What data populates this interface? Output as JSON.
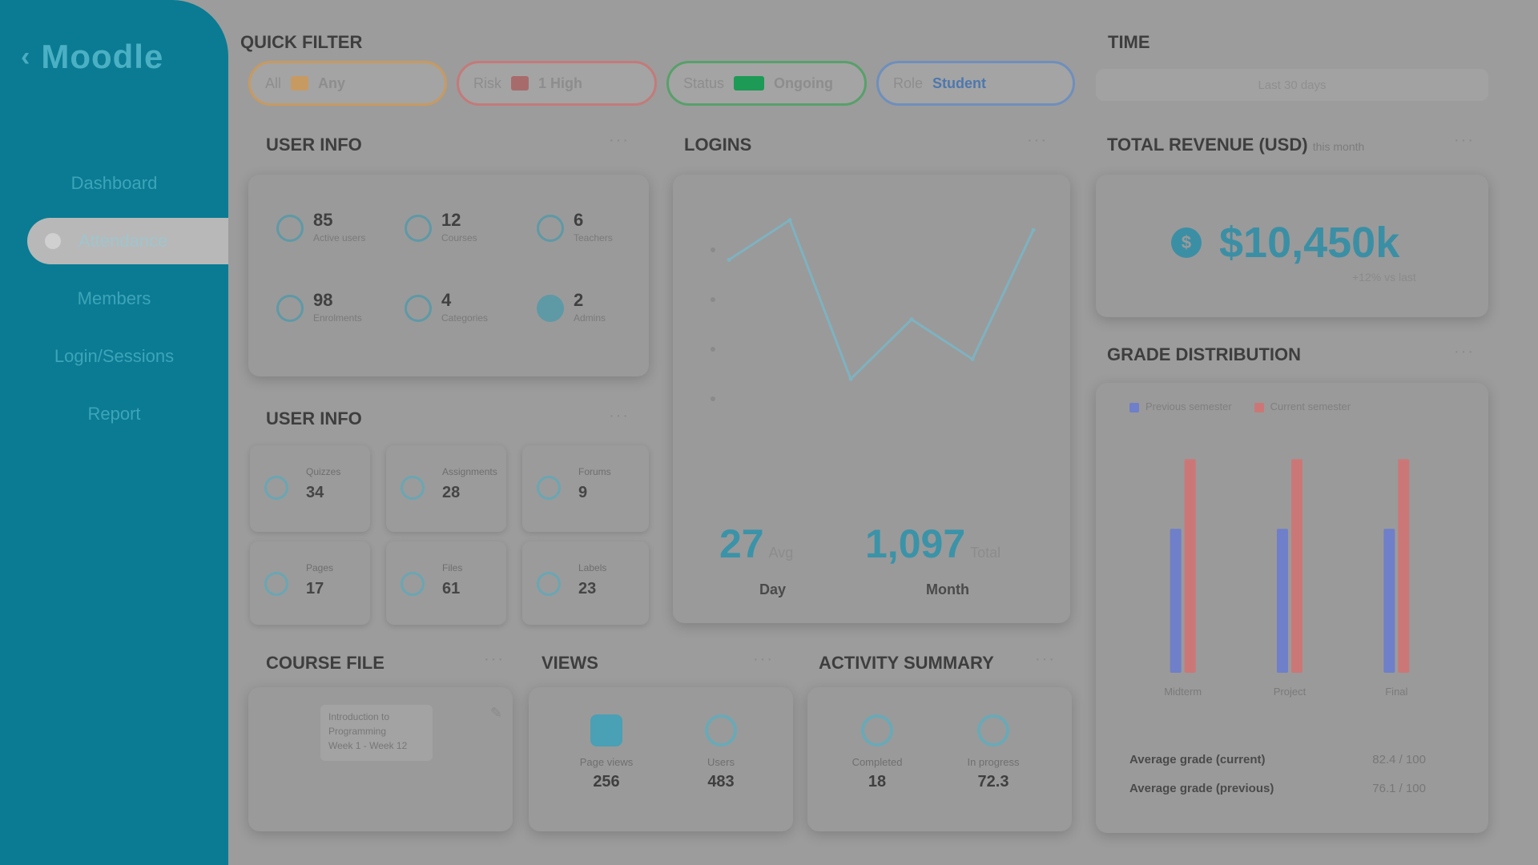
{
  "sidebar": {
    "brand": "Moodle",
    "items": [
      {
        "label": "Dashboard"
      },
      {
        "label": "Attendance"
      },
      {
        "label": "Members"
      },
      {
        "label": "Login/Sessions"
      },
      {
        "label": "Report"
      }
    ]
  },
  "filters": {
    "label": "QUICK FILTER",
    "chips": [
      {
        "text": "All",
        "value": "Any",
        "color": "#c79a62"
      },
      {
        "text": "Risk",
        "value": "1 High",
        "color": "#c47a7a"
      },
      {
        "text": "Status",
        "value": "Ongoing",
        "color": "#58a06a"
      },
      {
        "text": "Role",
        "value": "Student",
        "color": "#6e8fbd"
      }
    ]
  },
  "range": {
    "label": "TIME",
    "value": "Last 30 days"
  },
  "panels": {
    "info_a": {
      "title": "USER INFO"
    },
    "info_b": {
      "title": "USER INFO"
    },
    "chart": {
      "title": "LOGINS"
    },
    "total": {
      "title": "TOTAL REVENUE (USD)",
      "title_note": "this month",
      "value": "$10,450k",
      "sub": "+12% vs last"
    },
    "grouped": {
      "title": "GRADE DISTRIBUTION"
    },
    "course_file": {
      "title": "COURSE FILE"
    },
    "sessions": {
      "title": "VIEWS"
    },
    "activity": {
      "title": "ACTIVITY SUMMARY"
    }
  },
  "metrics_a": [
    {
      "num": "85",
      "sub": "Active users"
    },
    {
      "num": "12",
      "sub": "Courses"
    },
    {
      "num": "6",
      "sub": "Teachers"
    },
    {
      "num": "98",
      "sub": "Enrolments"
    },
    {
      "num": "4",
      "sub": "Categories"
    },
    {
      "num": "2",
      "sub": "Admins"
    }
  ],
  "tiles": [
    {
      "t1": "Quizzes",
      "t2": "34"
    },
    {
      "t1": "Assignments",
      "t2": "28"
    },
    {
      "t1": "Forums",
      "t2": "9"
    },
    {
      "t1": "Pages",
      "t2": "17"
    },
    {
      "t1": "Files",
      "t2": "61"
    },
    {
      "t1": "Labels",
      "t2": "23"
    }
  ],
  "chart_stats": [
    {
      "value": "27",
      "unit": "Avg",
      "label": "Day"
    },
    {
      "value": "1,097",
      "unit": "Total",
      "label": "Month"
    }
  ],
  "legend": [
    "Previous semester",
    "Current semester"
  ],
  "grade_categories": [
    "Midterm",
    "Project",
    "Final"
  ],
  "summary_rows": [
    {
      "k": "Average grade (current)",
      "v": "82.4 / 100"
    },
    {
      "k": "Average grade (previous)",
      "v": "76.1 / 100"
    }
  ],
  "course_file_text": [
    "Introduction to",
    "Programming",
    "Week 1 - Week 12"
  ],
  "views": [
    {
      "label": "Page views",
      "num": "256"
    },
    {
      "label": "Users",
      "num": "483"
    }
  ],
  "activity": [
    {
      "label": "Completed",
      "num": "18"
    },
    {
      "label": "In progress",
      "num": "72.3"
    }
  ],
  "chart_data": [
    {
      "type": "line",
      "title": "LOGINS",
      "x": [
        1,
        2,
        3,
        4,
        5,
        6
      ],
      "series": [
        {
          "values": [
            38,
            46,
            14,
            26,
            18,
            44
          ]
        }
      ],
      "ylim": [
        0,
        50
      ],
      "grid": false
    },
    {
      "type": "bar",
      "title": "GRADE DISTRIBUTION",
      "categories": [
        "Midterm",
        "Project",
        "Final"
      ],
      "series": [
        {
          "name": "Previous semester",
          "values": [
            62,
            62,
            62
          ]
        },
        {
          "name": "Current semester",
          "values": [
            92,
            92,
            92
          ]
        }
      ],
      "ylim": [
        0,
        100
      ]
    }
  ],
  "colors": {
    "sidebar": "#0a7b93",
    "accent": "#3b8fa5",
    "series_a": "#6f7fc9",
    "series_b": "#cc7777"
  }
}
